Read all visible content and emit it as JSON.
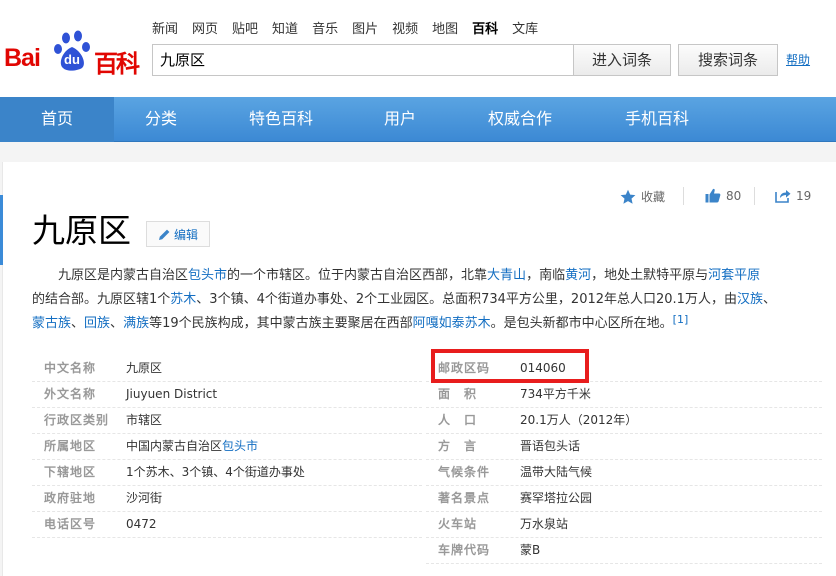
{
  "header": {
    "logo": {
      "text_bai": "Bai",
      "text_du": "du",
      "text_baike": "百科"
    },
    "topnav": [
      "新闻",
      "网页",
      "贴吧",
      "知道",
      "音乐",
      "图片",
      "视频",
      "地图",
      "百科",
      "文库"
    ],
    "topnav_active": "百科",
    "search_value": "九原区",
    "enter_label": "进入词条",
    "search_label": "搜索词条",
    "help_label": "帮助"
  },
  "mainnav": [
    "首页",
    "分类",
    "特色百科",
    "用户",
    "权威合作",
    "手机百科"
  ],
  "tools": {
    "collect": "收藏",
    "likes": "80",
    "shares": "19"
  },
  "title": "九原区",
  "edit_label": "编辑",
  "summary": {
    "l1a": "九原区是内蒙古自治区",
    "l1b": "包头市",
    "l1c": "的一个市辖区。位于内蒙古自治区西部，北靠",
    "l1d": "大青山",
    "l1e": "，南临",
    "l1f": "黄河",
    "l1g": "，地处土默特平原与",
    "l1h": "河套平原",
    "l2a": "的结合部。九原区辖1个",
    "l2b": "苏木",
    "l2c": "、3个镇、4个街道办事处、2个工业园区。总面积734平方公里，2012年总人口20.1万人，由",
    "l2d": "汉族",
    "l2e": "、",
    "l3a": "蒙古族",
    "l3b": "、",
    "l3c": "回族",
    "l3d": "、",
    "l3e": "满族",
    "l3f": "等19个民族构成，其中蒙古族主要聚居在西部",
    "l3g": "阿嘎如泰苏木",
    "l3h": "。是包头新都市中心区所在地。",
    "ref": "[1]"
  },
  "info_left": [
    {
      "label": "中文名称",
      "value": "九原区"
    },
    {
      "label": "外文名称",
      "value": "Jiuyuen District"
    },
    {
      "label": "行政区类别",
      "value": "市辖区"
    },
    {
      "label": "所属地区",
      "value_prefix": "中国内蒙古自治区",
      "value_link": "包头市"
    },
    {
      "label": "下辖地区",
      "value": "1个苏木、3个镇、4个街道办事处"
    },
    {
      "label": "政府驻地",
      "value_link": "沙河街"
    },
    {
      "label": "电话区号",
      "value": "0472"
    }
  ],
  "info_right": [
    {
      "label": "邮政区码",
      "value": "014060"
    },
    {
      "label": "面　积",
      "value": "734平方千米"
    },
    {
      "label": "人　口",
      "value": "20.1万人（2012年）"
    },
    {
      "label": "方　言",
      "value": "晋语包头话"
    },
    {
      "label": "气候条件",
      "value_link": "温带大陆气候"
    },
    {
      "label": "著名景点",
      "value_link": "赛罕塔拉公园"
    },
    {
      "label": "火车站",
      "value_link": "万水泉站"
    },
    {
      "label": "车牌代码",
      "value": "蒙B"
    }
  ],
  "colors": {
    "brand_red": "#e10602",
    "nav_blue": "#3c89d4",
    "link_blue": "#136ec2",
    "highlight": "#e81d1d"
  }
}
